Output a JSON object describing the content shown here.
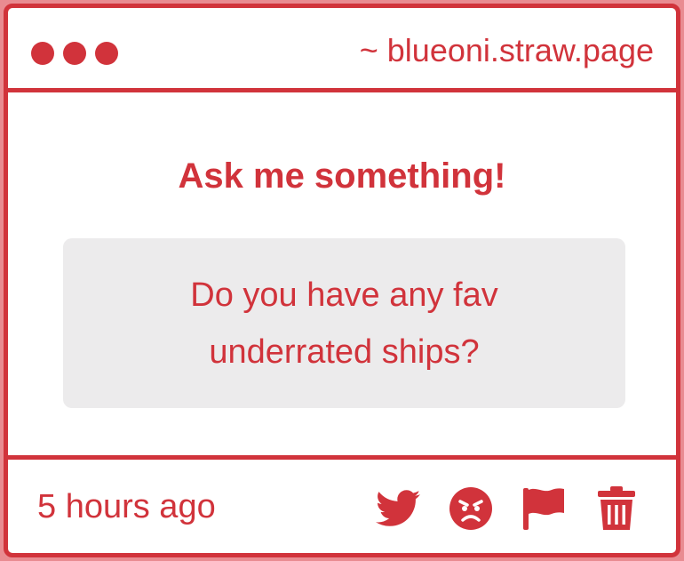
{
  "window": {
    "controls": [
      "dot",
      "dot",
      "dot"
    ],
    "url": "~ blueoni.straw.page"
  },
  "main": {
    "heading": "Ask me something!",
    "question": "Do you have any fav underrated ships?"
  },
  "footer": {
    "timestamp": "5 hours ago",
    "actions": [
      {
        "icon": "twitter-icon"
      },
      {
        "icon": "angry-face-icon"
      },
      {
        "icon": "flag-icon"
      },
      {
        "icon": "trash-icon"
      }
    ]
  },
  "colors": {
    "accent": "#d1333b",
    "background": "#e98b91",
    "question_box": "#ecebec"
  }
}
